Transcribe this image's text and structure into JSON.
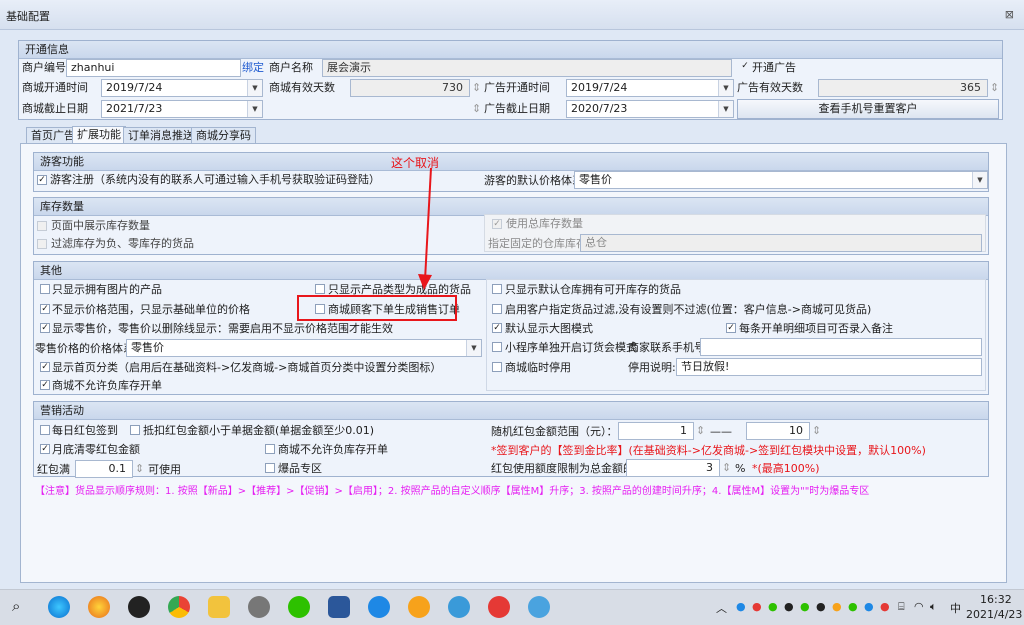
{
  "window": {
    "title": "基础配置",
    "close": "⊠"
  },
  "open_info": {
    "title": "开通信息",
    "merchant_no_label": "商户编号",
    "merchant_no": "zhanhui",
    "bind_label": "绑定",
    "merchant_name_label": "商户名称",
    "merchant_name": "展会演示",
    "open_ad_label": "开通广告",
    "mall_open_time_label": "商城开通时间",
    "mall_open_time": "2019/7/24",
    "mall_valid_days_label": "商城有效天数",
    "mall_valid_days": "730",
    "ad_open_time_label": "广告开通时间",
    "ad_open_time": "2019/7/24",
    "ad_valid_days_label": "广告有效天数",
    "ad_valid_days": "365",
    "mall_end_date_label": "商城截止日期",
    "mall_end_date": "2021/7/23",
    "ad_end_date_label": "广告截止日期",
    "ad_end_date": "2020/7/23",
    "reset_button": "查看手机号重置客户"
  },
  "tabs": [
    "首页广告",
    "扩展功能",
    "订单消息推送",
    "商城分享码"
  ],
  "guest": {
    "title": "游客功能",
    "register_label": "游客注册（系统内没有的联系人可通过输入手机号获取验证码登陆）",
    "price_system_label": "游客的默认价格体系",
    "price_system": "零售价"
  },
  "stock": {
    "title": "库存数量",
    "show_stock": "页面中展示库存数量",
    "filter_stock": "过滤库存为负、零库存的货品",
    "use_total_stock": "使用总库存数量",
    "fixed_warehouse_label": "指定固定的仓库库存",
    "fixed_warehouse": "总仓"
  },
  "other": {
    "title": "其他",
    "only_img": "只显示拥有图片的产品",
    "only_finished": "只显示产品类型为成品的货品",
    "no_price_range": "不显示价格范围，只显示基础单位的价格",
    "guest_sale_order": "商城顾客下单生成销售订单",
    "show_retail": "显示零售价，零售价以删除线显示：需要启用不显示价格范围才能生效",
    "retail_price_system_label": "零售价格的价格体系",
    "retail_price_system": "零售价",
    "show_home_category": "显示首页分类（启用后在基础资料->亿发商城->商城首页分类中设置分类图标）",
    "no_negative": "商城不允许负库存开单",
    "only_default_wh": "只显示默认仓库拥有可开库存的货品",
    "customer_filter": "启用客户指定货品过滤,没有设置则不过滤(位置：客户信息->商城可见货品)",
    "big_image": "默认显示大图模式",
    "detail_note": "每条开单明细项目可否录入备注",
    "mini_order": "小程序单独开启订货会模式",
    "merchant_phone_label": "商家联系手机号",
    "merchant_phone": "",
    "mall_pause": "商城临时停用",
    "pause_note_label": "停用说明:",
    "pause_note": "节日放假!"
  },
  "marketing": {
    "title": "营销活动",
    "daily_redpack": "每日红包签到",
    "deduct_label": "抵扣红包金额小于单据金额(单据金额至少0.01)",
    "month_end_redpack": "月底清零红包金额",
    "no_negative_stock": "商城不允许负库存开单",
    "redpack_full_label": "红包满",
    "redpack_full": "0.1",
    "usable_label": "可使用",
    "explosive_zone": "爆品专区",
    "random_range_label": "随机红包金额范围（元）：",
    "random_min": "1",
    "range_dash": "——",
    "random_max": "10",
    "sign_note": "*签到客户的【签到金比率】(在基础资料->亿发商城->签到红包模块中设置，默认100%)",
    "limit_label": "红包使用额度限制为总金额的",
    "limit_value": "3",
    "percent": "%",
    "max_note": "*(最高100%)"
  },
  "notice": "【注意】货品显示顺序规则：1. 按照【新品】>【推荐】>【促销】>【启用】；2. 按照产品的自定义顺序【属性M】升序；3. 按照产品的创建时间升序；4.【属性M】设置为\"\"时为爆品专区",
  "annotation": "这个取消",
  "taskbar": {
    "time": "16:32",
    "date": "2021/4/23",
    "ime": "中"
  },
  "colors": {
    "accent": "#e8161b",
    "note": "#e51ef2"
  }
}
